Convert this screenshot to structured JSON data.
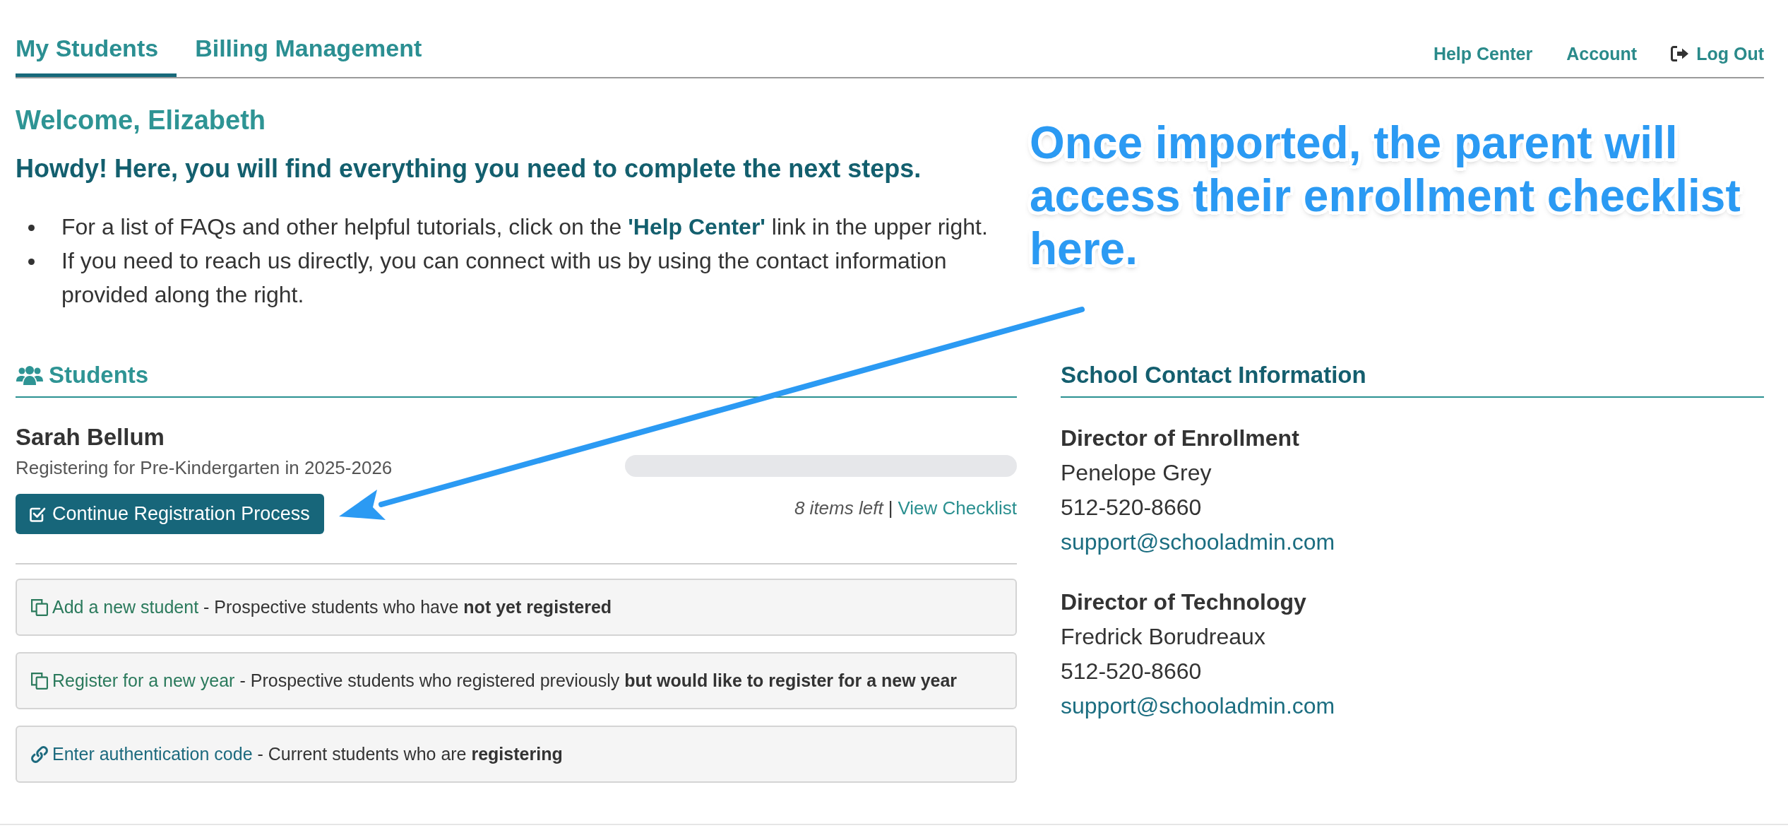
{
  "nav": {
    "tabs": [
      {
        "label": "My Students",
        "selected": true
      },
      {
        "label": "Billing Management",
        "selected": false
      }
    ],
    "links": [
      {
        "label": "Help Center",
        "kind": "text"
      },
      {
        "label": "Account",
        "kind": "text"
      },
      {
        "label": "Log Out",
        "kind": "logout"
      }
    ]
  },
  "welcome": {
    "title": "Welcome, Elizabeth",
    "subtitle": "Howdy! Here, you will find everything you need to complete the next steps.",
    "bullets": [
      "For a list of FAQs and other helpful tutorials, click on the **'Help Center'** link in the upper right.",
      "If you need to reach us directly, you can connect with us by using the contact information provided along the right."
    ]
  },
  "annotation": {
    "text": "Once imported, the parent will access their enrollment checklist here."
  },
  "students_section": {
    "title": "Students",
    "students": [
      {
        "name": "Sarah Bellum",
        "program": "Registering for Pre-Kindergarten in 2025-2026",
        "level": 0,
        "items_left": "8 items left",
        "separator": "|",
        "checklist_link": "View Checklist",
        "button": "Continue Registration Process"
      }
    ],
    "options": [
      {
        "kind": "copy",
        "link": "Add a new student",
        "description": "- Prospective students who have **not yet registered**"
      },
      {
        "kind": "copy",
        "link": "Register for a new year",
        "description": "- Prospective students who registered previously **but would like to register for a new year**"
      },
      {
        "kind": "link",
        "link": "Enter authentication code",
        "description": "- Current students who are **registering**"
      }
    ]
  },
  "contact_section": {
    "title": "School Contact Information",
    "contacts": [
      {
        "role": "Director of Enrollment",
        "name": "Penelope Grey",
        "phone": "512-520-8660",
        "email": "support@schooladmin.com"
      },
      {
        "role": "Director of Technology",
        "name": "Fredrick Borudreaux",
        "phone": "512-520-8660",
        "email": "support@schooladmin.com"
      }
    ]
  }
}
